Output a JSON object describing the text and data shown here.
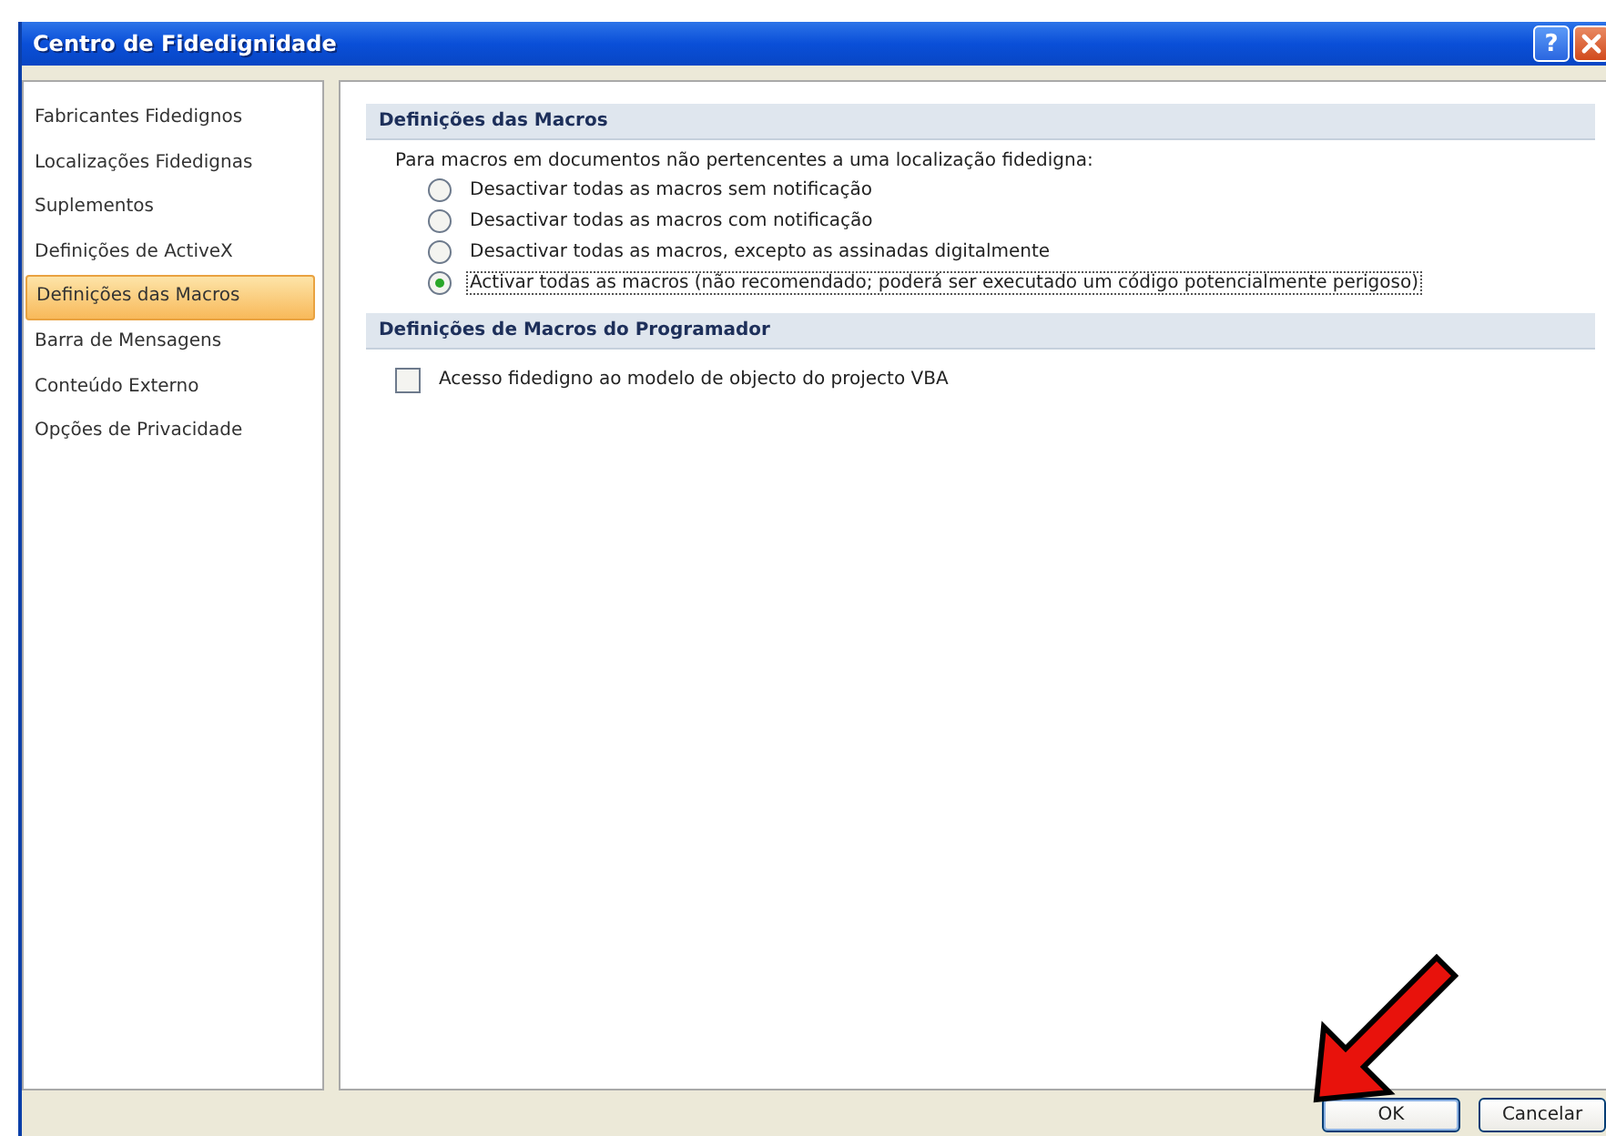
{
  "window": {
    "title": "Centro de Fidedignidade",
    "help": "?"
  },
  "sidebar": {
    "items": [
      {
        "label": "Fabricantes Fidedignos",
        "selected": false
      },
      {
        "label": "Localizações Fidedignas",
        "selected": false
      },
      {
        "label": "Suplementos",
        "selected": false
      },
      {
        "label": "Definições de ActiveX",
        "selected": false
      },
      {
        "label": "Definições das Macros",
        "selected": true
      },
      {
        "label": "Barra de Mensagens",
        "selected": false
      },
      {
        "label": "Conteúdo Externo",
        "selected": false
      },
      {
        "label": "Opções de Privacidade",
        "selected": false
      }
    ]
  },
  "sections": [
    {
      "title": "Definições das Macros",
      "intro": "Para macros em documentos não pertencentes a uma localização fidedigna:",
      "options": [
        {
          "kind": "radio",
          "label": "Desactivar todas as macros sem notificação",
          "selected": false
        },
        {
          "kind": "radio",
          "label": "Desactivar todas as macros com notificação",
          "selected": false
        },
        {
          "kind": "radio",
          "label": "Desactivar todas as macros, excepto as assinadas digitalmente",
          "selected": false
        },
        {
          "kind": "radio",
          "label": "Activar todas as macros (não recomendado; poderá ser executado um código potencialmente perigoso)",
          "selected": true
        }
      ]
    },
    {
      "title": "Definições de Macros do Programador",
      "options": [
        {
          "kind": "checkbox",
          "label": "Acesso fidedigno ao modelo de objecto do projecto VBA",
          "checked": false
        }
      ]
    }
  ],
  "buttons": [
    "OK",
    "Cancelar"
  ]
}
